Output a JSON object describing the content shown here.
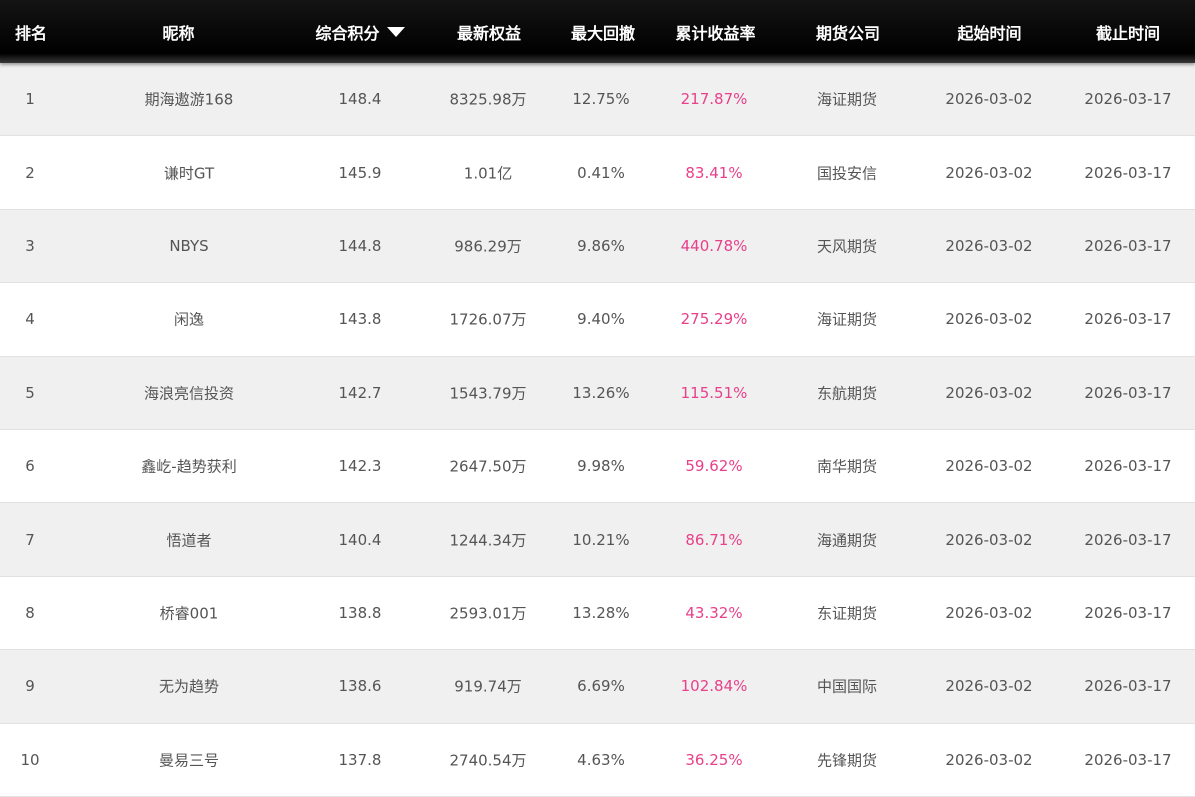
{
  "columns": {
    "rank": "排名",
    "nickname": "昵称",
    "score": "综合积分",
    "equity": "最新权益",
    "drawdown": "最大回撤",
    "return": "累计收益率",
    "company": "期货公司",
    "start": "起始时间",
    "end": "截止时间"
  },
  "sort_icon": "triangle-down-icon",
  "colors": {
    "header_bg": "#000000",
    "return_text": "#e8408a",
    "odd_row_bg": "#f0f0f0"
  },
  "rows": [
    {
      "rank": "1",
      "nickname": "期海遨游168",
      "score": "148.4",
      "equity": "8325.98万",
      "drawdown": "12.75%",
      "return": "217.87%",
      "company": "海证期货",
      "start": "2026-03-02",
      "end": "2026-03-17"
    },
    {
      "rank": "2",
      "nickname": "谦时GT",
      "score": "145.9",
      "equity": "1.01亿",
      "drawdown": "0.41%",
      "return": "83.41%",
      "company": "国投安信",
      "start": "2026-03-02",
      "end": "2026-03-17"
    },
    {
      "rank": "3",
      "nickname": "NBYS",
      "score": "144.8",
      "equity": "986.29万",
      "drawdown": "9.86%",
      "return": "440.78%",
      "company": "天风期货",
      "start": "2026-03-02",
      "end": "2026-03-17"
    },
    {
      "rank": "4",
      "nickname": "闲逸",
      "score": "143.8",
      "equity": "1726.07万",
      "drawdown": "9.40%",
      "return": "275.29%",
      "company": "海证期货",
      "start": "2026-03-02",
      "end": "2026-03-17"
    },
    {
      "rank": "5",
      "nickname": "海浪亮信投资",
      "score": "142.7",
      "equity": "1543.79万",
      "drawdown": "13.26%",
      "return": "115.51%",
      "company": "东航期货",
      "start": "2026-03-02",
      "end": "2026-03-17"
    },
    {
      "rank": "6",
      "nickname": "鑫屹-趋势获利",
      "score": "142.3",
      "equity": "2647.50万",
      "drawdown": "9.98%",
      "return": "59.62%",
      "company": "南华期货",
      "start": "2026-03-02",
      "end": "2026-03-17"
    },
    {
      "rank": "7",
      "nickname": "悟道者",
      "score": "140.4",
      "equity": "1244.34万",
      "drawdown": "10.21%",
      "return": "86.71%",
      "company": "海通期货",
      "start": "2026-03-02",
      "end": "2026-03-17"
    },
    {
      "rank": "8",
      "nickname": "桥睿001",
      "score": "138.8",
      "equity": "2593.01万",
      "drawdown": "13.28%",
      "return": "43.32%",
      "company": "东证期货",
      "start": "2026-03-02",
      "end": "2026-03-17"
    },
    {
      "rank": "9",
      "nickname": "无为趋势",
      "score": "138.6",
      "equity": "919.74万",
      "drawdown": "6.69%",
      "return": "102.84%",
      "company": "中国国际",
      "start": "2026-03-02",
      "end": "2026-03-17"
    },
    {
      "rank": "10",
      "nickname": "曼易三号",
      "score": "137.8",
      "equity": "2740.54万",
      "drawdown": "4.63%",
      "return": "36.25%",
      "company": "先锋期货",
      "start": "2026-03-02",
      "end": "2026-03-17"
    }
  ]
}
